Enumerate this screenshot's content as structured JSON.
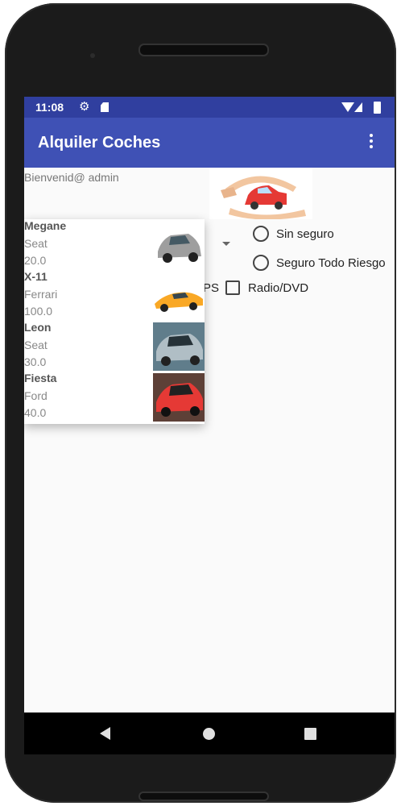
{
  "status_bar": {
    "time": "11:08"
  },
  "app_bar": {
    "title": "Alquiler Coches"
  },
  "welcome_text": "Bienvenid@ admin",
  "insurance_options": [
    {
      "label": "Sin seguro",
      "selected": false
    },
    {
      "label": "Seguro Todo Riesgo",
      "selected": false
    }
  ],
  "extras": {
    "partial_label": "PS",
    "radio_dvd_label": "Radio/DVD",
    "radio_dvd_checked": false
  },
  "car_list": [
    {
      "model": "Megane",
      "brand": "Seat",
      "price": "20.0",
      "image_icon": "silver-hatchback-car-icon"
    },
    {
      "model": "X-11",
      "brand": "Ferrari",
      "price": "100.0",
      "image_icon": "yellow-sports-car-icon"
    },
    {
      "model": "Leon",
      "brand": "Seat",
      "price": "30.0",
      "image_icon": "silver-sedan-car-icon"
    },
    {
      "model": "Fiesta",
      "brand": "Ford",
      "price": "40.0",
      "image_icon": "red-hatchback-car-icon"
    }
  ],
  "colors": {
    "status_bar": "#303f9f",
    "app_bar": "#3f51b5",
    "background": "#fafafa"
  }
}
